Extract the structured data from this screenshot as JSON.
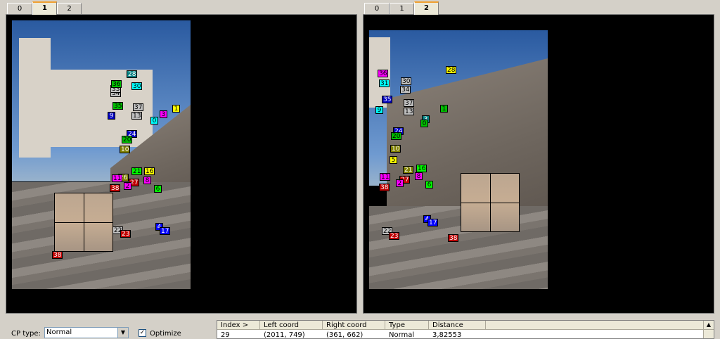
{
  "left_tabs": [
    "0",
    "1",
    "2"
  ],
  "right_tabs": [
    "0",
    "1",
    "2"
  ],
  "left_active_tab": "1",
  "right_active_tab": "2",
  "left_points": [
    "1",
    "3",
    "0",
    "37",
    "13",
    "35",
    "9",
    "34",
    "33",
    "30",
    "28",
    "36",
    "24",
    "20",
    "10",
    "16",
    "21",
    "26",
    "11",
    "8",
    "27",
    "2",
    "38",
    "6",
    "4",
    "17",
    "22",
    "23",
    "38"
  ],
  "right_points": [
    "28",
    "36",
    "31",
    "30",
    "34",
    "1",
    "35",
    "37",
    "13",
    "9",
    "3",
    "0",
    "24",
    "20",
    "10",
    "5",
    "16",
    "21",
    "11",
    "8",
    "27",
    "2",
    "38",
    "6",
    "4",
    "17",
    "22",
    "23",
    "38"
  ],
  "cp_type_label": "CP type:",
  "cp_type_value": "Normal",
  "optimize_label": "Optimize",
  "table": {
    "headers": [
      "Index >",
      "Left coord",
      "Right coord",
      "Type",
      "Distance"
    ],
    "row": [
      "29",
      "(2011, 749)",
      "(361, 662)",
      "Normal",
      "3,82553"
    ]
  }
}
